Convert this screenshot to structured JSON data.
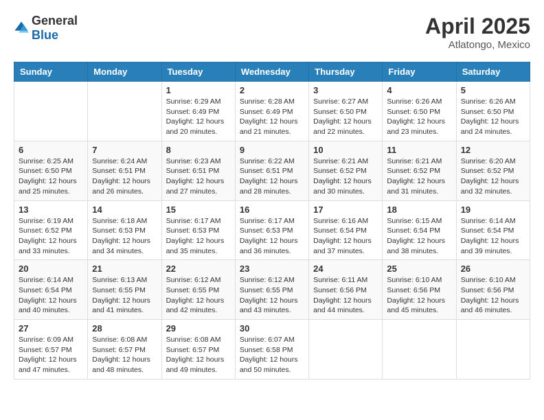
{
  "header": {
    "logo_general": "General",
    "logo_blue": "Blue",
    "title": "April 2025",
    "location": "Atlatongo, Mexico"
  },
  "weekdays": [
    "Sunday",
    "Monday",
    "Tuesday",
    "Wednesday",
    "Thursday",
    "Friday",
    "Saturday"
  ],
  "weeks": [
    [
      {
        "day": null,
        "info": null
      },
      {
        "day": null,
        "info": null
      },
      {
        "day": "1",
        "sunrise": "Sunrise: 6:29 AM",
        "sunset": "Sunset: 6:49 PM",
        "daylight": "Daylight: 12 hours and 20 minutes."
      },
      {
        "day": "2",
        "sunrise": "Sunrise: 6:28 AM",
        "sunset": "Sunset: 6:49 PM",
        "daylight": "Daylight: 12 hours and 21 minutes."
      },
      {
        "day": "3",
        "sunrise": "Sunrise: 6:27 AM",
        "sunset": "Sunset: 6:50 PM",
        "daylight": "Daylight: 12 hours and 22 minutes."
      },
      {
        "day": "4",
        "sunrise": "Sunrise: 6:26 AM",
        "sunset": "Sunset: 6:50 PM",
        "daylight": "Daylight: 12 hours and 23 minutes."
      },
      {
        "day": "5",
        "sunrise": "Sunrise: 6:26 AM",
        "sunset": "Sunset: 6:50 PM",
        "daylight": "Daylight: 12 hours and 24 minutes."
      }
    ],
    [
      {
        "day": "6",
        "sunrise": "Sunrise: 6:25 AM",
        "sunset": "Sunset: 6:50 PM",
        "daylight": "Daylight: 12 hours and 25 minutes."
      },
      {
        "day": "7",
        "sunrise": "Sunrise: 6:24 AM",
        "sunset": "Sunset: 6:51 PM",
        "daylight": "Daylight: 12 hours and 26 minutes."
      },
      {
        "day": "8",
        "sunrise": "Sunrise: 6:23 AM",
        "sunset": "Sunset: 6:51 PM",
        "daylight": "Daylight: 12 hours and 27 minutes."
      },
      {
        "day": "9",
        "sunrise": "Sunrise: 6:22 AM",
        "sunset": "Sunset: 6:51 PM",
        "daylight": "Daylight: 12 hours and 28 minutes."
      },
      {
        "day": "10",
        "sunrise": "Sunrise: 6:21 AM",
        "sunset": "Sunset: 6:52 PM",
        "daylight": "Daylight: 12 hours and 30 minutes."
      },
      {
        "day": "11",
        "sunrise": "Sunrise: 6:21 AM",
        "sunset": "Sunset: 6:52 PM",
        "daylight": "Daylight: 12 hours and 31 minutes."
      },
      {
        "day": "12",
        "sunrise": "Sunrise: 6:20 AM",
        "sunset": "Sunset: 6:52 PM",
        "daylight": "Daylight: 12 hours and 32 minutes."
      }
    ],
    [
      {
        "day": "13",
        "sunrise": "Sunrise: 6:19 AM",
        "sunset": "Sunset: 6:52 PM",
        "daylight": "Daylight: 12 hours and 33 minutes."
      },
      {
        "day": "14",
        "sunrise": "Sunrise: 6:18 AM",
        "sunset": "Sunset: 6:53 PM",
        "daylight": "Daylight: 12 hours and 34 minutes."
      },
      {
        "day": "15",
        "sunrise": "Sunrise: 6:17 AM",
        "sunset": "Sunset: 6:53 PM",
        "daylight": "Daylight: 12 hours and 35 minutes."
      },
      {
        "day": "16",
        "sunrise": "Sunrise: 6:17 AM",
        "sunset": "Sunset: 6:53 PM",
        "daylight": "Daylight: 12 hours and 36 minutes."
      },
      {
        "day": "17",
        "sunrise": "Sunrise: 6:16 AM",
        "sunset": "Sunset: 6:54 PM",
        "daylight": "Daylight: 12 hours and 37 minutes."
      },
      {
        "day": "18",
        "sunrise": "Sunrise: 6:15 AM",
        "sunset": "Sunset: 6:54 PM",
        "daylight": "Daylight: 12 hours and 38 minutes."
      },
      {
        "day": "19",
        "sunrise": "Sunrise: 6:14 AM",
        "sunset": "Sunset: 6:54 PM",
        "daylight": "Daylight: 12 hours and 39 minutes."
      }
    ],
    [
      {
        "day": "20",
        "sunrise": "Sunrise: 6:14 AM",
        "sunset": "Sunset: 6:54 PM",
        "daylight": "Daylight: 12 hours and 40 minutes."
      },
      {
        "day": "21",
        "sunrise": "Sunrise: 6:13 AM",
        "sunset": "Sunset: 6:55 PM",
        "daylight": "Daylight: 12 hours and 41 minutes."
      },
      {
        "day": "22",
        "sunrise": "Sunrise: 6:12 AM",
        "sunset": "Sunset: 6:55 PM",
        "daylight": "Daylight: 12 hours and 42 minutes."
      },
      {
        "day": "23",
        "sunrise": "Sunrise: 6:12 AM",
        "sunset": "Sunset: 6:55 PM",
        "daylight": "Daylight: 12 hours and 43 minutes."
      },
      {
        "day": "24",
        "sunrise": "Sunrise: 6:11 AM",
        "sunset": "Sunset: 6:56 PM",
        "daylight": "Daylight: 12 hours and 44 minutes."
      },
      {
        "day": "25",
        "sunrise": "Sunrise: 6:10 AM",
        "sunset": "Sunset: 6:56 PM",
        "daylight": "Daylight: 12 hours and 45 minutes."
      },
      {
        "day": "26",
        "sunrise": "Sunrise: 6:10 AM",
        "sunset": "Sunset: 6:56 PM",
        "daylight": "Daylight: 12 hours and 46 minutes."
      }
    ],
    [
      {
        "day": "27",
        "sunrise": "Sunrise: 6:09 AM",
        "sunset": "Sunset: 6:57 PM",
        "daylight": "Daylight: 12 hours and 47 minutes."
      },
      {
        "day": "28",
        "sunrise": "Sunrise: 6:08 AM",
        "sunset": "Sunset: 6:57 PM",
        "daylight": "Daylight: 12 hours and 48 minutes."
      },
      {
        "day": "29",
        "sunrise": "Sunrise: 6:08 AM",
        "sunset": "Sunset: 6:57 PM",
        "daylight": "Daylight: 12 hours and 49 minutes."
      },
      {
        "day": "30",
        "sunrise": "Sunrise: 6:07 AM",
        "sunset": "Sunset: 6:58 PM",
        "daylight": "Daylight: 12 hours and 50 minutes."
      },
      {
        "day": null,
        "info": null
      },
      {
        "day": null,
        "info": null
      },
      {
        "day": null,
        "info": null
      }
    ]
  ]
}
